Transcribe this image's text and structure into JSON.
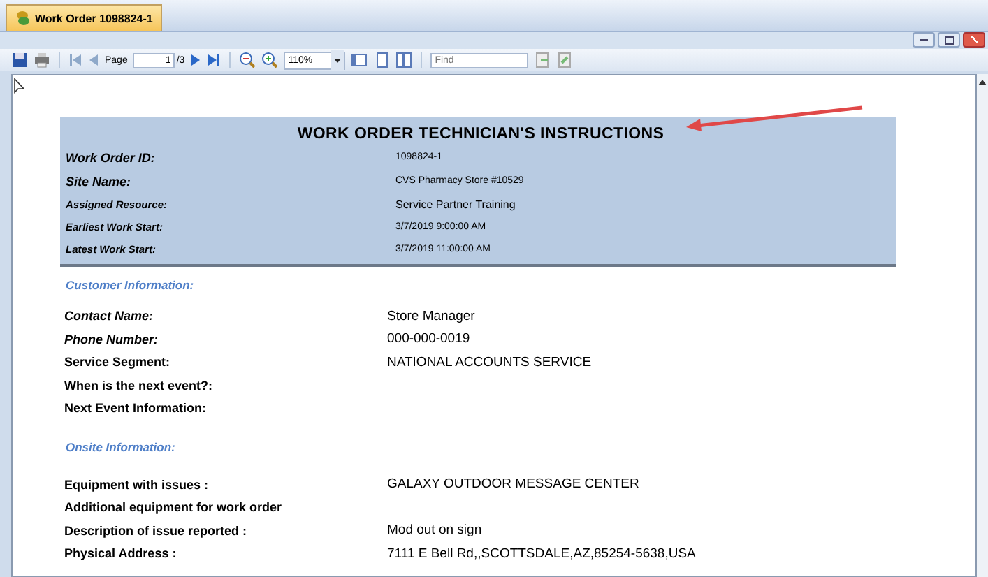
{
  "tab": {
    "title": "Work Order 1098824-1",
    "selected": true
  },
  "toolbar": {
    "page_label": "Page",
    "page_value": "1",
    "page_total": "/3",
    "zoom": "110%",
    "find": {
      "placeholder": "Find"
    }
  },
  "report": {
    "title": "WORK ORDER TECHNICIAN'S INSTRUCTIONS",
    "header_rows": [
      {
        "label": "Work Order ID:",
        "value": "1098824-1",
        "kind": "large"
      },
      {
        "label": "Site Name:",
        "value": "CVS Pharmacy Store #10529",
        "kind": "large"
      },
      {
        "label": "Assigned Resource:",
        "value": "Service Partner Training",
        "kind": "small"
      },
      {
        "label": "Earliest Work Start:",
        "value": "3/7/2019 9:00:00 AM",
        "kind": "small"
      },
      {
        "label": "Latest Work Start:",
        "value": "3/7/2019 11:00:00 AM",
        "kind": "small"
      }
    ],
    "sections": [
      {
        "title": "Customer Information:",
        "rows": [
          {
            "label": "Contact Name:",
            "value": "Store Manager",
            "kind": "italic"
          },
          {
            "label": "Phone Number:",
            "value": "000-000-0019",
            "kind": "italic"
          },
          {
            "label": "Service Segment:",
            "value": "NATIONAL ACCOUNTS SERVICE",
            "kind": "plain"
          },
          {
            "label": "When is the next event?:",
            "kind": "plain"
          },
          {
            "label": "Next Event Information:",
            "kind": "plain"
          }
        ]
      },
      {
        "title": "Onsite Information:",
        "rows": [
          {
            "label": "Equipment with issues :",
            "value": "GALAXY OUTDOOR MESSAGE CENTER",
            "kind": "plain"
          },
          {
            "label": "Additional equipment for work order",
            "kind": "plain"
          },
          {
            "label": "Description of issue reported :",
            "value": "Mod out on sign",
            "kind": "plain"
          },
          {
            "label": "Physical Address :",
            "value": "7111 E Bell Rd,,SCOTTSDALE,AZ,85254-5638,USA",
            "kind": "plain"
          }
        ]
      }
    ]
  }
}
